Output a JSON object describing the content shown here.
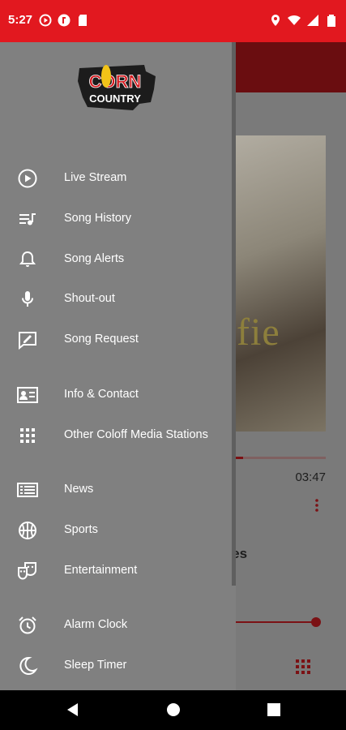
{
  "status_bar": {
    "time": "5:27",
    "background": "#e2181f"
  },
  "app": {
    "album_text": "fie",
    "time_total": "03:47",
    "song_title_partial": "cles",
    "progress": 0.33,
    "volume": 0.9,
    "accent": "#b3161c"
  },
  "drawer": {
    "logo": {
      "top": "CORN",
      "bottom": "COUNTRY"
    },
    "items": [
      {
        "label": "Live Stream",
        "icon": "play-circle-icon"
      },
      {
        "label": "Song History",
        "icon": "playlist-icon"
      },
      {
        "label": "Song Alerts",
        "icon": "bell-icon"
      },
      {
        "label": "Shout-out",
        "icon": "microphone-icon"
      },
      {
        "label": "Song Request",
        "icon": "request-icon"
      },
      {
        "label": "Info & Contact",
        "icon": "contact-card-icon"
      },
      {
        "label": "Other Coloff Media Stations",
        "icon": "apps-grid-icon"
      },
      {
        "label": "News",
        "icon": "newspaper-icon"
      },
      {
        "label": "Sports",
        "icon": "basketball-icon"
      },
      {
        "label": "Entertainment",
        "icon": "theater-masks-icon"
      },
      {
        "label": "Alarm Clock",
        "icon": "alarm-clock-icon"
      },
      {
        "label": "Sleep Timer",
        "icon": "moon-icon"
      }
    ]
  }
}
